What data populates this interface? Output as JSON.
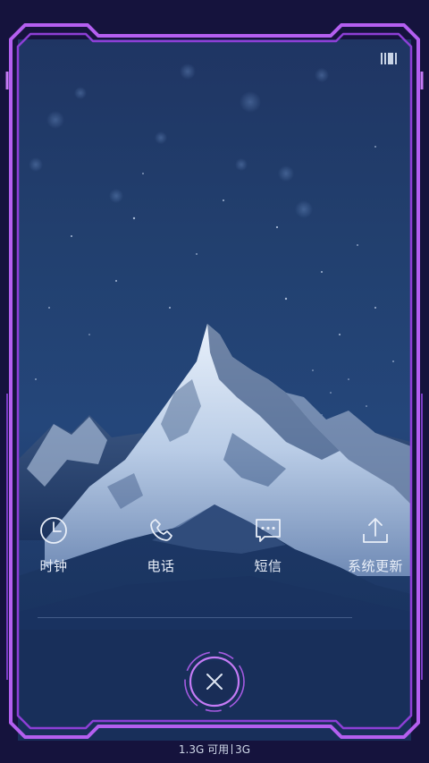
{
  "apps": [
    {
      "label": "时钟",
      "icon": "clock-icon"
    },
    {
      "label": "电话",
      "icon": "phone-icon"
    },
    {
      "label": "短信",
      "icon": "message-icon"
    },
    {
      "label": "系统更新",
      "icon": "upload-icon"
    }
  ],
  "close": {
    "icon": "close-icon"
  },
  "status": {
    "left": "1.3G 可用",
    "right": "3G"
  },
  "colors": {
    "frame": "#b45ff0",
    "frame_bg": "#15133d",
    "wallpaper_sky": "#22406f",
    "text": "#e8eef8"
  }
}
